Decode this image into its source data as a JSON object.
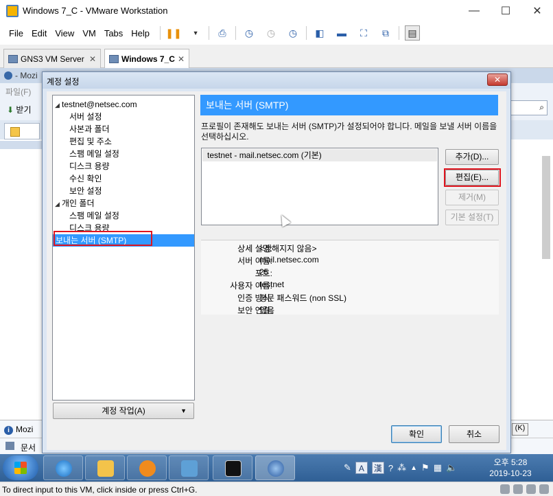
{
  "vmware": {
    "title": "Windows 7_C - VMware Workstation",
    "menus": [
      "File",
      "Edit",
      "View",
      "VM",
      "Tabs",
      "Help"
    ],
    "tabs": [
      {
        "label": "GNS3 VM Server"
      },
      {
        "label": "Windows 7_C"
      }
    ],
    "status_message": "To direct input to this VM, click inside or press Ctrl+G."
  },
  "guest": {
    "window_title": "- Mozi",
    "menu_file": "파일(F)",
    "receive": "받기",
    "bottom_app": "Mozi",
    "bottom_doc": "문서",
    "bottom_btn": "(K)"
  },
  "dialog": {
    "title": "계정 설정",
    "close_glyph": "✕",
    "tree": [
      {
        "label": "testnet@netsec.com",
        "level": 0,
        "expander": "◢"
      },
      {
        "label": "서버 설정",
        "level": 1
      },
      {
        "label": "사본과 폴더",
        "level": 1
      },
      {
        "label": "편집 및 주소",
        "level": 1
      },
      {
        "label": "스팸 메일 설정",
        "level": 1
      },
      {
        "label": "디스크 용량",
        "level": 1
      },
      {
        "label": "수신 확인",
        "level": 1
      },
      {
        "label": "보안 설정",
        "level": 1
      },
      {
        "label": "개인 폴더",
        "level": 0,
        "expander": "◢"
      },
      {
        "label": "스팸 메일 설정",
        "level": 1
      },
      {
        "label": "디스크 용량",
        "level": 1
      },
      {
        "label": "보내는 서버 (SMTP)",
        "level": 0,
        "selected": true
      }
    ],
    "account_actions": "계정 작업(A)",
    "panel_title": "보내는 서버 (SMTP)",
    "description": "프로필이 존재해도 보내는 서버 (SMTP)가 설정되어야 합니다. 메일을 보낼 서버 이름을 선택하십시오.",
    "servers": [
      "testnet - mail.netsec.com (기본)"
    ],
    "buttons": {
      "add": "추가(D)...",
      "edit": "편집(E)...",
      "remove": "제거(M)",
      "set_default": "기본 설정(T)"
    },
    "details": [
      {
        "label": "상세 설명:",
        "value": "<정해지지 않음>"
      },
      {
        "label": "서버 이름:",
        "value": "mail.netsec.com"
      },
      {
        "label": "포트:",
        "value": "25"
      },
      {
        "label": "사용자 이름:",
        "value": "testnet"
      },
      {
        "label": "인증 방식:",
        "value": "평문 패스워드 (non SSL)"
      },
      {
        "label": "보안 연결:",
        "value": "없음"
      }
    ],
    "ok": "확인",
    "cancel": "취소"
  },
  "taskbar": {
    "ime_a": "A",
    "ime_han": "漢",
    "time": "오후 5:28",
    "date": "2019-10-23"
  },
  "colors": {
    "selection": "#3399ff",
    "highlight_red": "#e0141e",
    "taskbar": "#3a6aa0"
  }
}
